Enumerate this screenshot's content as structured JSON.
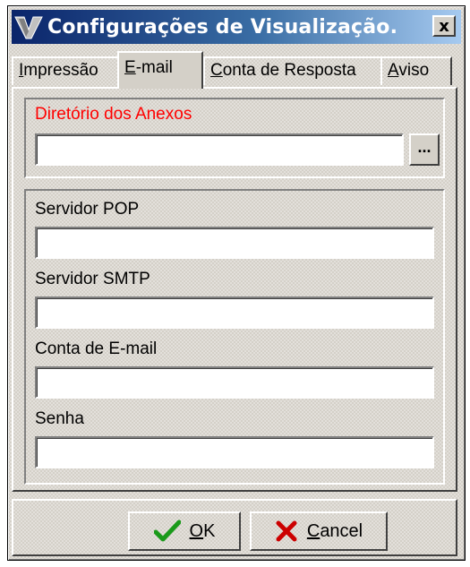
{
  "window": {
    "title": "Configurações de Visualização.",
    "close_glyph": "x",
    "app_icon": "v-logo-icon"
  },
  "tabs": [
    {
      "label": "Impressão",
      "mnemonic": "I",
      "rest": "mpressão",
      "active": false
    },
    {
      "label": "E-mail",
      "mnemonic": "E",
      "rest": "-mail",
      "active": true
    },
    {
      "label": "Conta de Resposta",
      "mnemonic": "C",
      "rest": "onta de Resposta",
      "active": false
    },
    {
      "label": "Aviso",
      "mnemonic": "A",
      "rest": "viso",
      "active": false
    }
  ],
  "attachments": {
    "label": "Diretório dos Anexos",
    "label_color": "#ff0000",
    "value": "",
    "browse_label": "..."
  },
  "server": {
    "pop_label": "Servidor POP",
    "pop_value": "",
    "smtp_label": "Servidor SMTP",
    "smtp_value": "",
    "account_label": "Conta de E-mail",
    "account_value": "",
    "password_label": "Senha",
    "password_value": ""
  },
  "buttons": {
    "ok_mnemonic": "O",
    "ok_rest": "K",
    "ok_icon": "checkmark-icon",
    "cancel_mnemonic": "C",
    "cancel_rest": "ancel",
    "cancel_icon": "red-x-icon"
  },
  "colors": {
    "title_gradient_start": "#0a246a",
    "title_gradient_end": "#a6caf0",
    "face": "#d4d0c8",
    "ok_check": "#1a9a1a",
    "cancel_x": "#cc0000"
  }
}
